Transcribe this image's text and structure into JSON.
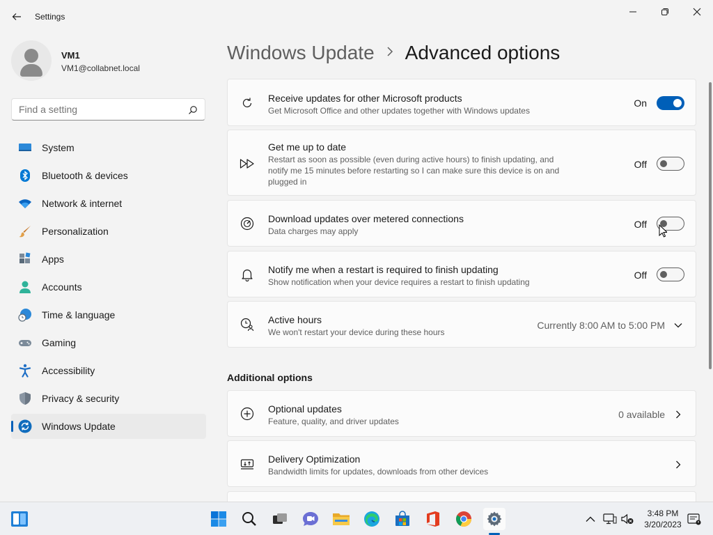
{
  "window": {
    "title": "Settings"
  },
  "profile": {
    "name": "VM1",
    "email": "VM1@collabnet.local"
  },
  "search": {
    "placeholder": "Find a setting"
  },
  "sidebar": {
    "items": [
      {
        "label": "System",
        "icon": "system-icon"
      },
      {
        "label": "Bluetooth & devices",
        "icon": "bluetooth-icon"
      },
      {
        "label": "Network & internet",
        "icon": "wifi-icon"
      },
      {
        "label": "Personalization",
        "icon": "brush-icon"
      },
      {
        "label": "Apps",
        "icon": "apps-icon"
      },
      {
        "label": "Accounts",
        "icon": "accounts-icon"
      },
      {
        "label": "Time & language",
        "icon": "clock-globe-icon"
      },
      {
        "label": "Gaming",
        "icon": "gamepad-icon"
      },
      {
        "label": "Accessibility",
        "icon": "accessibility-icon"
      },
      {
        "label": "Privacy & security",
        "icon": "shield-icon"
      },
      {
        "label": "Windows Update",
        "icon": "update-icon",
        "active": true
      }
    ]
  },
  "breadcrumb": {
    "parent": "Windows Update",
    "current": "Advanced options"
  },
  "settings": {
    "receive_updates": {
      "title": "Receive updates for other Microsoft products",
      "desc": "Get Microsoft Office and other updates together with Windows updates",
      "state": "On"
    },
    "get_up_to_date": {
      "title": "Get me up to date",
      "desc": "Restart as soon as possible (even during active hours) to finish updating, and notify me 15 minutes before restarting so I can make sure this device is on and plugged in",
      "state": "Off"
    },
    "metered": {
      "title": "Download updates over metered connections",
      "desc": "Data charges may apply",
      "state": "Off"
    },
    "notify_restart": {
      "title": "Notify me when a restart is required to finish updating",
      "desc": "Show notification when your device requires a restart to finish updating",
      "state": "Off"
    },
    "active_hours": {
      "title": "Active hours",
      "desc": "We won't restart your device during these hours",
      "value": "Currently 8:00 AM to 5:00 PM"
    }
  },
  "additional": {
    "heading": "Additional options",
    "optional_updates": {
      "title": "Optional updates",
      "desc": "Feature, quality, and driver updates",
      "value": "0 available"
    },
    "delivery_optimization": {
      "title": "Delivery Optimization",
      "desc": "Bandwidth limits for updates, downloads from other devices"
    }
  },
  "taskbar": {
    "time": "3:48 PM",
    "date": "3/20/2023"
  },
  "colors": {
    "accent": "#005fb8",
    "background": "#f3f3f3",
    "card": "#fbfbfb"
  }
}
